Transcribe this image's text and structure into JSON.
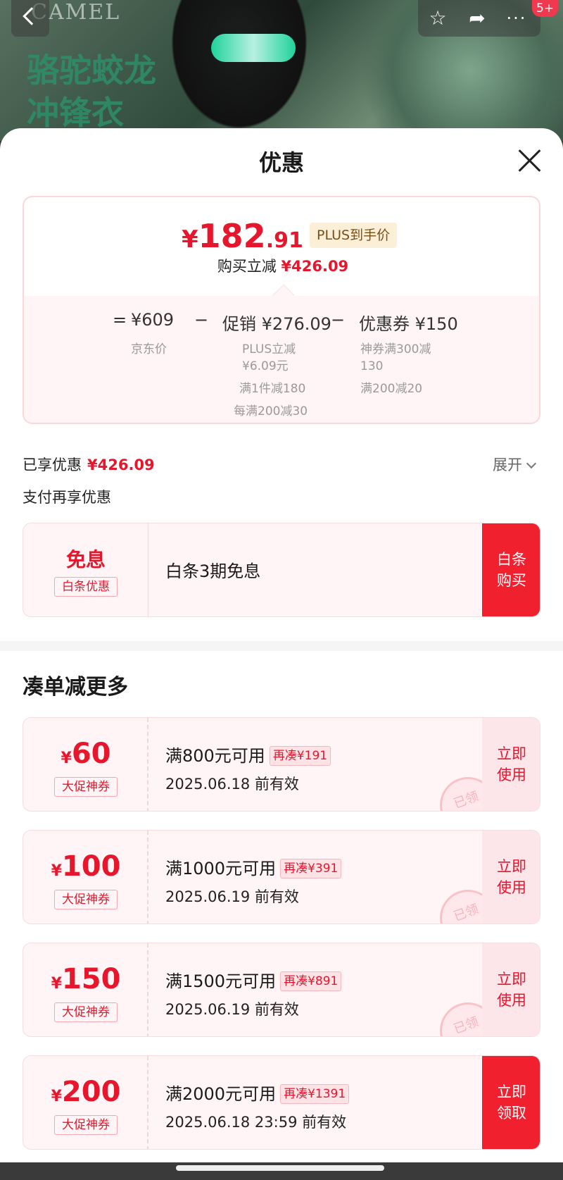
{
  "banner": {
    "brand": "CAMEL",
    "headline_line1": "骆驼蛟龙",
    "headline_line2": "冲锋衣",
    "notification_badge": "5+"
  },
  "icons": {
    "back": "chevron-left-icon",
    "star": "star-icon",
    "share": "share-icon",
    "more": "more-icon",
    "close": "close-icon",
    "expand": "chevron-down-icon"
  },
  "sheet": {
    "title": "优惠"
  },
  "price_card": {
    "currency": "¥",
    "price_int": "182",
    "price_dec": ".91",
    "plus_tag": "PLUS到手价",
    "buy_reduce_label": "购买立减",
    "buy_reduce_value": "¥426.09",
    "formula": {
      "eq": "=",
      "base_value": "¥609",
      "base_label": "京东价",
      "minus1": "−",
      "promo_label": "促销",
      "promo_value": "¥276.09",
      "promo_sub1": "PLUS立减",
      "promo_sub2": "¥6.09元",
      "promo_sub3": "满1件减180",
      "promo_sub4": "每满200减30",
      "minus2": "−",
      "coupon_label": "优惠券",
      "coupon_value": "¥150",
      "coupon_sub1": "神券满300减",
      "coupon_sub2": "130",
      "coupon_sub3": "满200减20"
    }
  },
  "enjoyed": {
    "label": "已享优惠",
    "value": "¥426.09",
    "expand_label": "展开"
  },
  "pay_more": {
    "label": "支付再享优惠"
  },
  "baitiao": {
    "main": "免息",
    "sub": "白条优惠",
    "text": "白条3期免息",
    "buy_line1": "白条",
    "buy_line2": "购买"
  },
  "more_section": {
    "title": "凑单减更多"
  },
  "coupons": [
    {
      "sym": "¥",
      "amount": "60",
      "type": "大促神券",
      "cond": "满800元可用",
      "more": "再凑¥191",
      "valid": "2025.06.18 前有效",
      "act_line1": "立即",
      "act_line2": "使用",
      "stamp": "已领"
    },
    {
      "sym": "¥",
      "amount": "100",
      "type": "大促神券",
      "cond": "满1000元可用",
      "more": "再凑¥391",
      "valid": "2025.06.19 前有效",
      "act_line1": "立即",
      "act_line2": "使用",
      "stamp": "已领"
    },
    {
      "sym": "¥",
      "amount": "150",
      "type": "大促神券",
      "cond": "满1500元可用",
      "more": "再凑¥891",
      "valid": "2025.06.19 前有效",
      "act_line1": "立即",
      "act_line2": "使用",
      "stamp": "已领"
    },
    {
      "sym": "¥",
      "amount": "200",
      "type": "大促神券",
      "cond": "满2000元可用",
      "more": "再凑¥1391",
      "valid": "2025.06.18 23:59 前有效",
      "act_line1": "立即",
      "act_line2": "领取"
    }
  ],
  "colors": {
    "accent_red": "#e6162d",
    "button_red": "#f0202f",
    "card_bg": "#fff5f6",
    "plus_bg": "#fbefd8"
  }
}
